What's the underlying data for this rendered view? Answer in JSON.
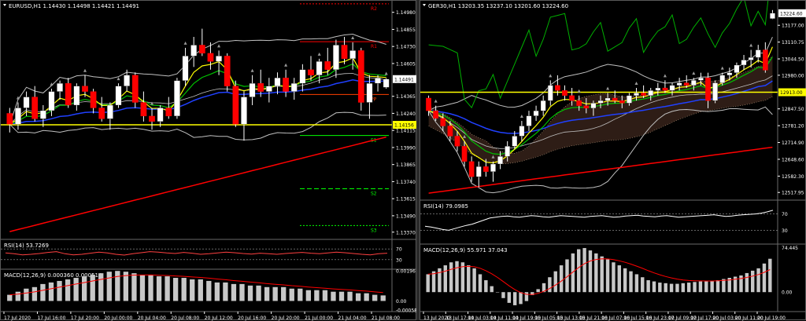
{
  "chart_data": [
    {
      "type": "candlestick",
      "title": "EURUSD,H1  1.14430 1.14498 1.14421 1.14491",
      "price_axis": [
        "1.14980",
        "1.14855",
        "1.14730",
        "1.14605",
        "1.14491",
        "1.14365",
        "1.14240",
        "1.14156",
        "1.14115",
        "1.13990",
        "1.13865",
        "1.13740",
        "1.13615",
        "1.13490",
        "1.13370"
      ],
      "ylim": [
        1.1334,
        1.1503
      ],
      "current_price": "1.14491",
      "highlight_price": "1.14156",
      "pivot_levels": [
        {
          "name": "R2",
          "value": 1.15042,
          "color": "#ff0000"
        },
        {
          "name": "R1",
          "value": 1.14765,
          "color": "#ff0000"
        },
        {
          "name": "PP",
          "value": 1.14378,
          "color": "#ff4000"
        },
        {
          "name": "S1",
          "value": 1.14078,
          "color": "#00ff00"
        },
        {
          "name": "S2",
          "value": 1.13688,
          "color": "#00ff00"
        },
        {
          "name": "S3",
          "value": 1.13418,
          "color": "#00ff00"
        }
      ],
      "time_axis": [
        "17 Jul 2020",
        "17 Jul 16:00",
        "17 Jul 20:00",
        "20 Jul 00:00",
        "20 Jul 04:00",
        "20 Jul 08:00",
        "20 Jul 12:00",
        "20 Jul 16:00",
        "20 Jul 20:00",
        "21 Jul 00:00",
        "21 Jul 04:00",
        "21 Jul 08:00"
      ],
      "rsi": {
        "label": "RSI(14) 53.7269",
        "levels": [
          "70",
          "30"
        ],
        "values": [
          55,
          52,
          48,
          50,
          53,
          57,
          60,
          52,
          48,
          50,
          54,
          58,
          55,
          50,
          47,
          52,
          56,
          60,
          58,
          55,
          53,
          57,
          54,
          50,
          52,
          55,
          58,
          56,
          53,
          51,
          54,
          52,
          50,
          53,
          55,
          57,
          54,
          52,
          55,
          58,
          56,
          53,
          50,
          48,
          52,
          54
        ]
      },
      "macd": {
        "label": "MACD(12,26,9) 0.000360 0.000514",
        "ticks": [
          "0.00196",
          "0.00",
          "-0.000588"
        ],
        "histogram": [
          0.0004,
          0.0006,
          0.0008,
          0.0009,
          0.0011,
          0.0012,
          0.0013,
          0.0014,
          0.0015,
          0.0016,
          0.0017,
          0.0018,
          0.0019,
          0.00195,
          0.0019,
          0.0018,
          0.0017,
          0.0017,
          0.0016,
          0.0016,
          0.0015,
          0.0015,
          0.0014,
          0.0014,
          0.0013,
          0.0012,
          0.0012,
          0.0011,
          0.0011,
          0.001,
          0.001,
          0.0009,
          0.0009,
          0.0009,
          0.0008,
          0.0008,
          0.0007,
          0.0007,
          0.0007,
          0.0006,
          0.0006,
          0.0006,
          0.0005,
          0.0005,
          0.0004,
          0.00036
        ],
        "ylim": [
          -0.000588,
          0.00196
        ]
      },
      "candles": [
        [
          1.1424,
          1.1428,
          1.141,
          1.1416
        ],
        [
          1.1416,
          1.1432,
          1.1412,
          1.1428
        ],
        [
          1.1428,
          1.144,
          1.1422,
          1.1436
        ],
        [
          1.1436,
          1.1444,
          1.1418,
          1.142
        ],
        [
          1.142,
          1.143,
          1.1414,
          1.1426
        ],
        [
          1.1426,
          1.1442,
          1.1422,
          1.144
        ],
        [
          1.144,
          1.1448,
          1.1434,
          1.1446
        ],
        [
          1.1446,
          1.145,
          1.1428,
          1.143
        ],
        [
          1.143,
          1.1446,
          1.1426,
          1.1444
        ],
        [
          1.1444,
          1.1452,
          1.1436,
          1.144
        ],
        [
          1.144,
          1.1442,
          1.1424,
          1.1428
        ],
        [
          1.1428,
          1.1436,
          1.1418,
          1.142
        ],
        [
          1.142,
          1.1432,
          1.1412,
          1.143
        ],
        [
          1.143,
          1.1446,
          1.1428,
          1.1444
        ],
        [
          1.1444,
          1.1456,
          1.144,
          1.1452
        ],
        [
          1.1452,
          1.1454,
          1.1428,
          1.1432
        ],
        [
          1.1432,
          1.144,
          1.1418,
          1.1422
        ],
        [
          1.1422,
          1.1428,
          1.1412,
          1.1418
        ],
        [
          1.1418,
          1.143,
          1.1414,
          1.1428
        ],
        [
          1.1428,
          1.1436,
          1.142,
          1.1422
        ],
        [
          1.1422,
          1.145,
          1.142,
          1.1448
        ],
        [
          1.1448,
          1.1472,
          1.1444,
          1.1466
        ],
        [
          1.1466,
          1.148,
          1.1458,
          1.1474
        ],
        [
          1.1474,
          1.1486,
          1.1466,
          1.1468
        ],
        [
          1.1468,
          1.1476,
          1.1456,
          1.1462
        ],
        [
          1.1462,
          1.147,
          1.1452,
          1.1466
        ],
        [
          1.1466,
          1.1468,
          1.144,
          1.1444
        ],
        [
          1.1444,
          1.1448,
          1.1414,
          1.1416
        ],
        [
          1.1416,
          1.144,
          1.1404,
          1.1436
        ],
        [
          1.1436,
          1.1452,
          1.143,
          1.1446
        ],
        [
          1.1446,
          1.1456,
          1.1436,
          1.144
        ],
        [
          1.144,
          1.145,
          1.1432,
          1.1444
        ],
        [
          1.1444,
          1.1454,
          1.1438,
          1.145
        ],
        [
          1.145,
          1.1456,
          1.1436,
          1.144
        ],
        [
          1.144,
          1.145,
          1.1434,
          1.1446
        ],
        [
          1.1446,
          1.146,
          1.144,
          1.1456
        ],
        [
          1.1456,
          1.1466,
          1.1448,
          1.1452
        ],
        [
          1.1452,
          1.1464,
          1.1446,
          1.1462
        ],
        [
          1.1462,
          1.1472,
          1.1452,
          1.1456
        ],
        [
          1.1456,
          1.1478,
          1.145,
          1.1474
        ],
        [
          1.1474,
          1.148,
          1.146,
          1.1464
        ],
        [
          1.1464,
          1.1476,
          1.1456,
          1.147
        ],
        [
          1.147,
          1.1472,
          1.1426,
          1.1432
        ],
        [
          1.1432,
          1.1452,
          1.142,
          1.1446
        ],
        [
          1.1446,
          1.1452,
          1.144,
          1.145
        ],
        [
          1.1443,
          1.14498,
          1.14421,
          1.14491
        ]
      ]
    },
    {
      "type": "candlestick",
      "title": "GER30,H1  13203.35 13237.10 13201.60 13224.60",
      "price_axis": [
        "13224.60",
        "13177.00",
        "13110.75",
        "13044.50",
        "12980.00",
        "12913.00",
        "12847.50",
        "12781.20",
        "12714.90",
        "12648.60",
        "12582.30",
        "12517.95"
      ],
      "ylim": [
        12500,
        13255
      ],
      "current_price": "13224.60",
      "highlight_price": "12913.00",
      "time_axis": [
        "13 Jul 2020",
        "13 Jul 17:00",
        "14 Jul 03:00",
        "14 Jul 11:00",
        "14 Jul 19:00",
        "15 Jul 05:00",
        "15 Jul 13:00",
        "15 Jul 21:00",
        "16 Jul 07:00",
        "16 Jul 15:00",
        "16 Jul 23:00",
        "17 Jul 09:00",
        "17 Jul 17:00",
        "20 Jul 03:00",
        "20 Jul 11:00",
        "20 Jul 19:00"
      ],
      "rsi": {
        "label": "RSI(14) 79.0985",
        "levels": [
          "70",
          "30"
        ],
        "values": [
          40,
          38,
          35,
          32,
          30,
          34,
          38,
          42,
          45,
          50,
          55,
          60,
          62,
          64,
          65,
          63,
          62,
          64,
          66,
          65,
          63,
          62,
          64,
          66,
          65,
          64,
          63,
          62,
          64,
          65,
          66,
          64,
          62,
          63,
          65,
          66,
          67,
          65,
          64,
          63,
          65,
          66,
          64,
          62,
          63,
          64,
          65,
          66,
          67,
          68,
          66,
          64,
          65,
          67,
          68,
          69,
          70,
          72,
          75,
          79
        ]
      },
      "macd": {
        "label": "MACD(12,26,9) 55.971 37.043",
        "ticks": [
          "74.445",
          "0.00"
        ],
        "histogram": [
          30,
          35,
          40,
          45,
          50,
          52,
          50,
          45,
          40,
          30,
          20,
          10,
          0,
          -10,
          -18,
          -22,
          -20,
          -15,
          -5,
          5,
          15,
          25,
          35,
          45,
          55,
          65,
          72,
          74,
          70,
          65,
          60,
          55,
          50,
          45,
          40,
          35,
          30,
          25,
          20,
          18,
          16,
          15,
          14,
          14,
          15,
          16,
          17,
          18,
          18,
          19,
          20,
          22,
          24,
          26,
          28,
          32,
          36,
          40,
          48,
          56
        ],
        "ylim": [
          -30,
          78
        ]
      },
      "candles": [
        [
          12890,
          12900,
          12820,
          12840
        ],
        [
          12840,
          12860,
          12800,
          12810
        ],
        [
          12810,
          12830,
          12760,
          12780
        ],
        [
          12780,
          12800,
          12720,
          12740
        ],
        [
          12740,
          12760,
          12680,
          12700
        ],
        [
          12700,
          12720,
          12620,
          12640
        ],
        [
          12640,
          12660,
          12560,
          12580
        ],
        [
          12580,
          12640,
          12540,
          12620
        ],
        [
          12620,
          12650,
          12580,
          12600
        ],
        [
          12600,
          12640,
          12560,
          12630
        ],
        [
          12630,
          12680,
          12610,
          12660
        ],
        [
          12660,
          12720,
          12640,
          12700
        ],
        [
          12700,
          12760,
          12690,
          12740
        ],
        [
          12740,
          12800,
          12720,
          12780
        ],
        [
          12780,
          12840,
          12760,
          12820
        ],
        [
          12820,
          12860,
          12800,
          12840
        ],
        [
          12840,
          12900,
          12820,
          12880
        ],
        [
          12880,
          12960,
          12860,
          12940
        ],
        [
          12940,
          12980,
          12900,
          12920
        ],
        [
          12920,
          12940,
          12880,
          12900
        ],
        [
          12900,
          12930,
          12860,
          12880
        ],
        [
          12880,
          12900,
          12840,
          12860
        ],
        [
          12860,
          12890,
          12830,
          12850
        ],
        [
          12850,
          12880,
          12820,
          12870
        ],
        [
          12870,
          12900,
          12850,
          12880
        ],
        [
          12880,
          12910,
          12860,
          12890
        ],
        [
          12890,
          12920,
          12870,
          12880
        ],
        [
          12880,
          12900,
          12850,
          12870
        ],
        [
          12870,
          12910,
          12860,
          12900
        ],
        [
          12900,
          12930,
          12880,
          12910
        ],
        [
          12910,
          12940,
          12890,
          12900
        ],
        [
          12900,
          12930,
          12880,
          12920
        ],
        [
          12920,
          12950,
          12900,
          12930
        ],
        [
          12930,
          12960,
          12910,
          12920
        ],
        [
          12920,
          12950,
          12900,
          12940
        ],
        [
          12940,
          12970,
          12920,
          12950
        ],
        [
          12950,
          12980,
          12930,
          12940
        ],
        [
          12940,
          12970,
          12920,
          12960
        ],
        [
          12960,
          12990,
          12940,
          12970
        ],
        [
          12970,
          12990,
          12850,
          12880
        ],
        [
          12880,
          12960,
          12870,
          12950
        ],
        [
          12950,
          12990,
          12940,
          12980
        ],
        [
          12980,
          13010,
          12960,
          12990
        ],
        [
          12990,
          13030,
          12970,
          13020
        ],
        [
          13020,
          13060,
          13000,
          13040
        ],
        [
          13040,
          13080,
          13010,
          13050
        ],
        [
          13050,
          13100,
          13030,
          13080
        ],
        [
          13080,
          13110,
          12990,
          13000
        ],
        [
          13203.35,
          13237.1,
          13201.6,
          13224.6
        ]
      ]
    }
  ]
}
